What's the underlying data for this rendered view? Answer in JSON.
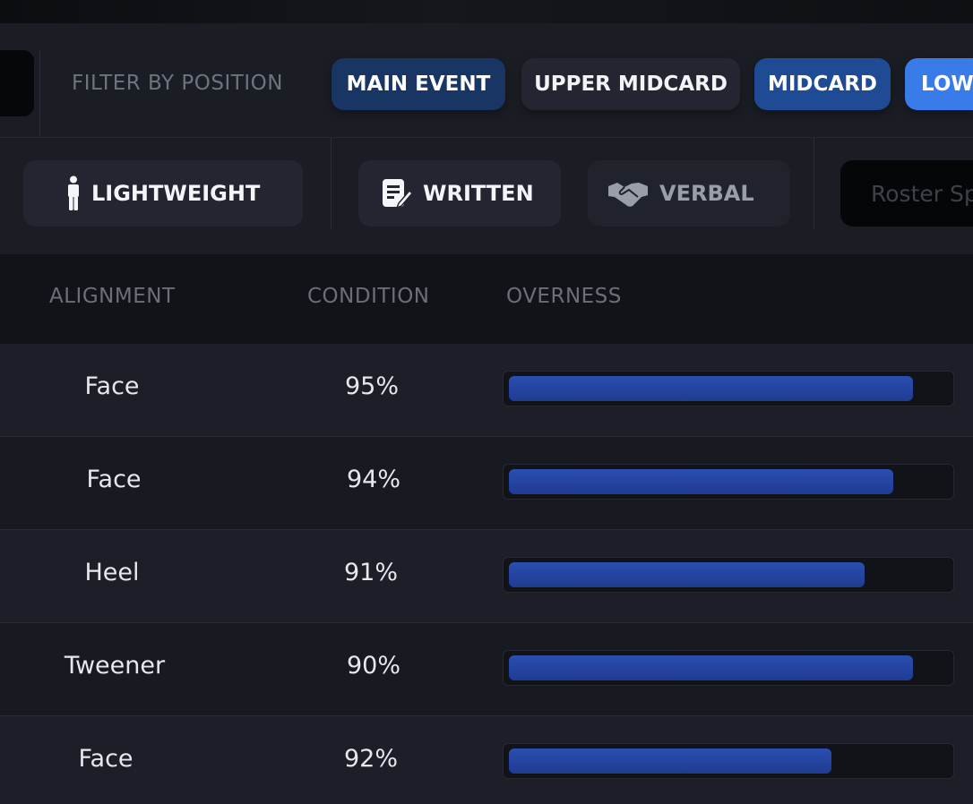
{
  "filters": {
    "position_label": "FILTER BY POSITION",
    "positions": [
      {
        "label": "MAIN EVENT",
        "state": "selected-dark"
      },
      {
        "label": "UPPER MIDCARD",
        "state": "unselected"
      },
      {
        "label": "MIDCARD",
        "state": "selected"
      },
      {
        "label": "LOW",
        "state": "active"
      }
    ],
    "weight": {
      "label": "LIGHTWEIGHT",
      "icon": "person-icon"
    },
    "contract_types": [
      {
        "label": "WRITTEN",
        "icon": "document-pen-icon",
        "active": true
      },
      {
        "label": "VERBAL",
        "icon": "handshake-icon",
        "active": false
      }
    ],
    "search_placeholder": "Roster Sp"
  },
  "table": {
    "columns": [
      "ALIGNMENT",
      "CONDITION",
      "OVERNESS"
    ],
    "rows": [
      {
        "alignment": "Face",
        "condition": "95%",
        "overness": 0.92
      },
      {
        "alignment": "Face",
        "condition": "94%",
        "overness": 0.876
      },
      {
        "alignment": "Heel",
        "condition": "91%",
        "overness": 0.81
      },
      {
        "alignment": "Tweener",
        "condition": "90%",
        "overness": 0.92
      },
      {
        "alignment": "Face",
        "condition": "92%",
        "overness": 0.734
      }
    ]
  },
  "colors": {
    "bar_fill": "#2a4ba9",
    "active_pill": "#3a7bea",
    "selected_pill": "#1f4a94",
    "dark_pill": "#183564"
  }
}
